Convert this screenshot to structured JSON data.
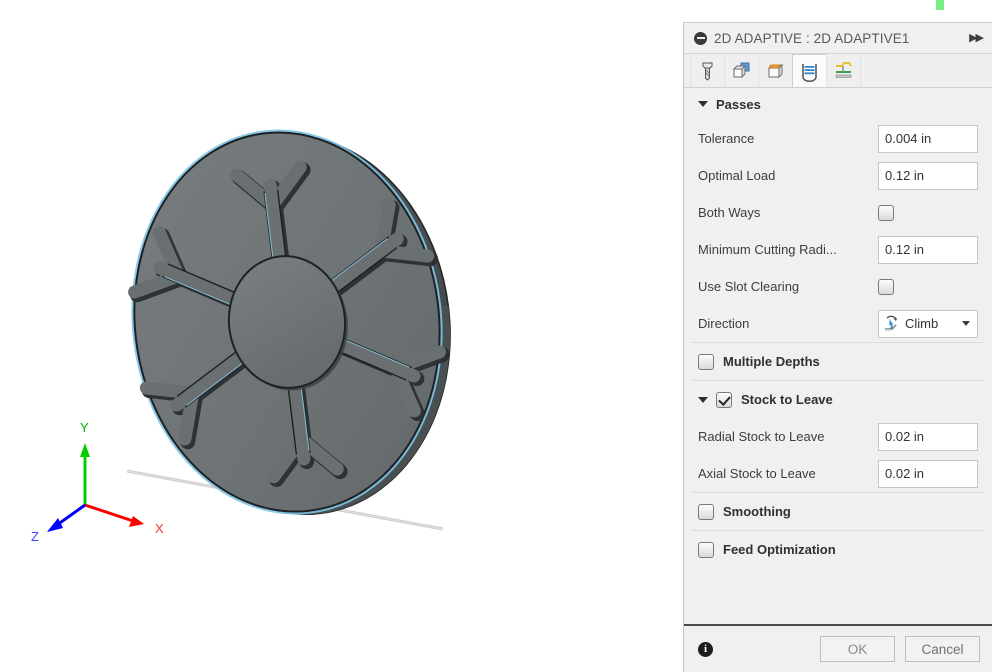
{
  "viewport": {
    "axis_triad": {
      "x_label": "X",
      "y_label": "Y",
      "z_label": "Z",
      "x_color": "#ff0000",
      "y_color": "#00cc00",
      "z_color": "#0000ff"
    },
    "model": {
      "name": "snowflake-disc-part",
      "body_color": "#6f7476",
      "selection_highlight_color": "#6fb7d8",
      "edge_color": "#1d1f20",
      "ground_line_color": "#c9c9c9",
      "spokes": 6
    }
  },
  "panel": {
    "header": {
      "title": "2D ADAPTIVE : 2D ADAPTIVE1",
      "collapse_icon": "collapse-minus-icon",
      "expand_icon": "double-right-arrow-icon"
    },
    "tabs": [
      {
        "name": "tool",
        "icon": "endmill-tool-icon",
        "selected": false
      },
      {
        "name": "geometry",
        "icon": "geometry-cube-icon",
        "selected": false
      },
      {
        "name": "heights",
        "icon": "heights-cube-icon",
        "selected": false
      },
      {
        "name": "passes",
        "icon": "passes-layers-icon",
        "selected": true
      },
      {
        "name": "linking",
        "icon": "linking-ramp-icon",
        "selected": false
      }
    ],
    "sections": {
      "passes": {
        "label": "Passes",
        "expanded": true,
        "rows": {
          "tolerance": {
            "label": "Tolerance",
            "value": "0.004 in"
          },
          "optimal_load": {
            "label": "Optimal Load",
            "value": "0.12 in"
          },
          "both_ways": {
            "label": "Both Ways",
            "checked": false
          },
          "minimum_cutting_radius": {
            "label": "Minimum Cutting Radi...",
            "value": "0.12 in"
          },
          "use_slot_clearing": {
            "label": "Use Slot Clearing",
            "checked": false
          },
          "direction": {
            "label": "Direction",
            "value": "Climb",
            "icon": "climb-direction-icon"
          }
        }
      },
      "multiple_depths": {
        "label": "Multiple Depths",
        "checked": false
      },
      "stock_to_leave": {
        "label": "Stock to Leave",
        "checked": true,
        "expanded": true,
        "rows": {
          "radial": {
            "label": "Radial Stock to Leave",
            "value": "0.02 in"
          },
          "axial": {
            "label": "Axial Stock to Leave",
            "value": "0.02 in"
          }
        }
      },
      "smoothing": {
        "label": "Smoothing",
        "checked": false
      },
      "feed_optimization": {
        "label": "Feed Optimization",
        "checked": false
      }
    },
    "footer": {
      "info_icon": "info-icon",
      "info_glyph": "i",
      "ok_label": "OK",
      "cancel_label": "Cancel"
    }
  }
}
